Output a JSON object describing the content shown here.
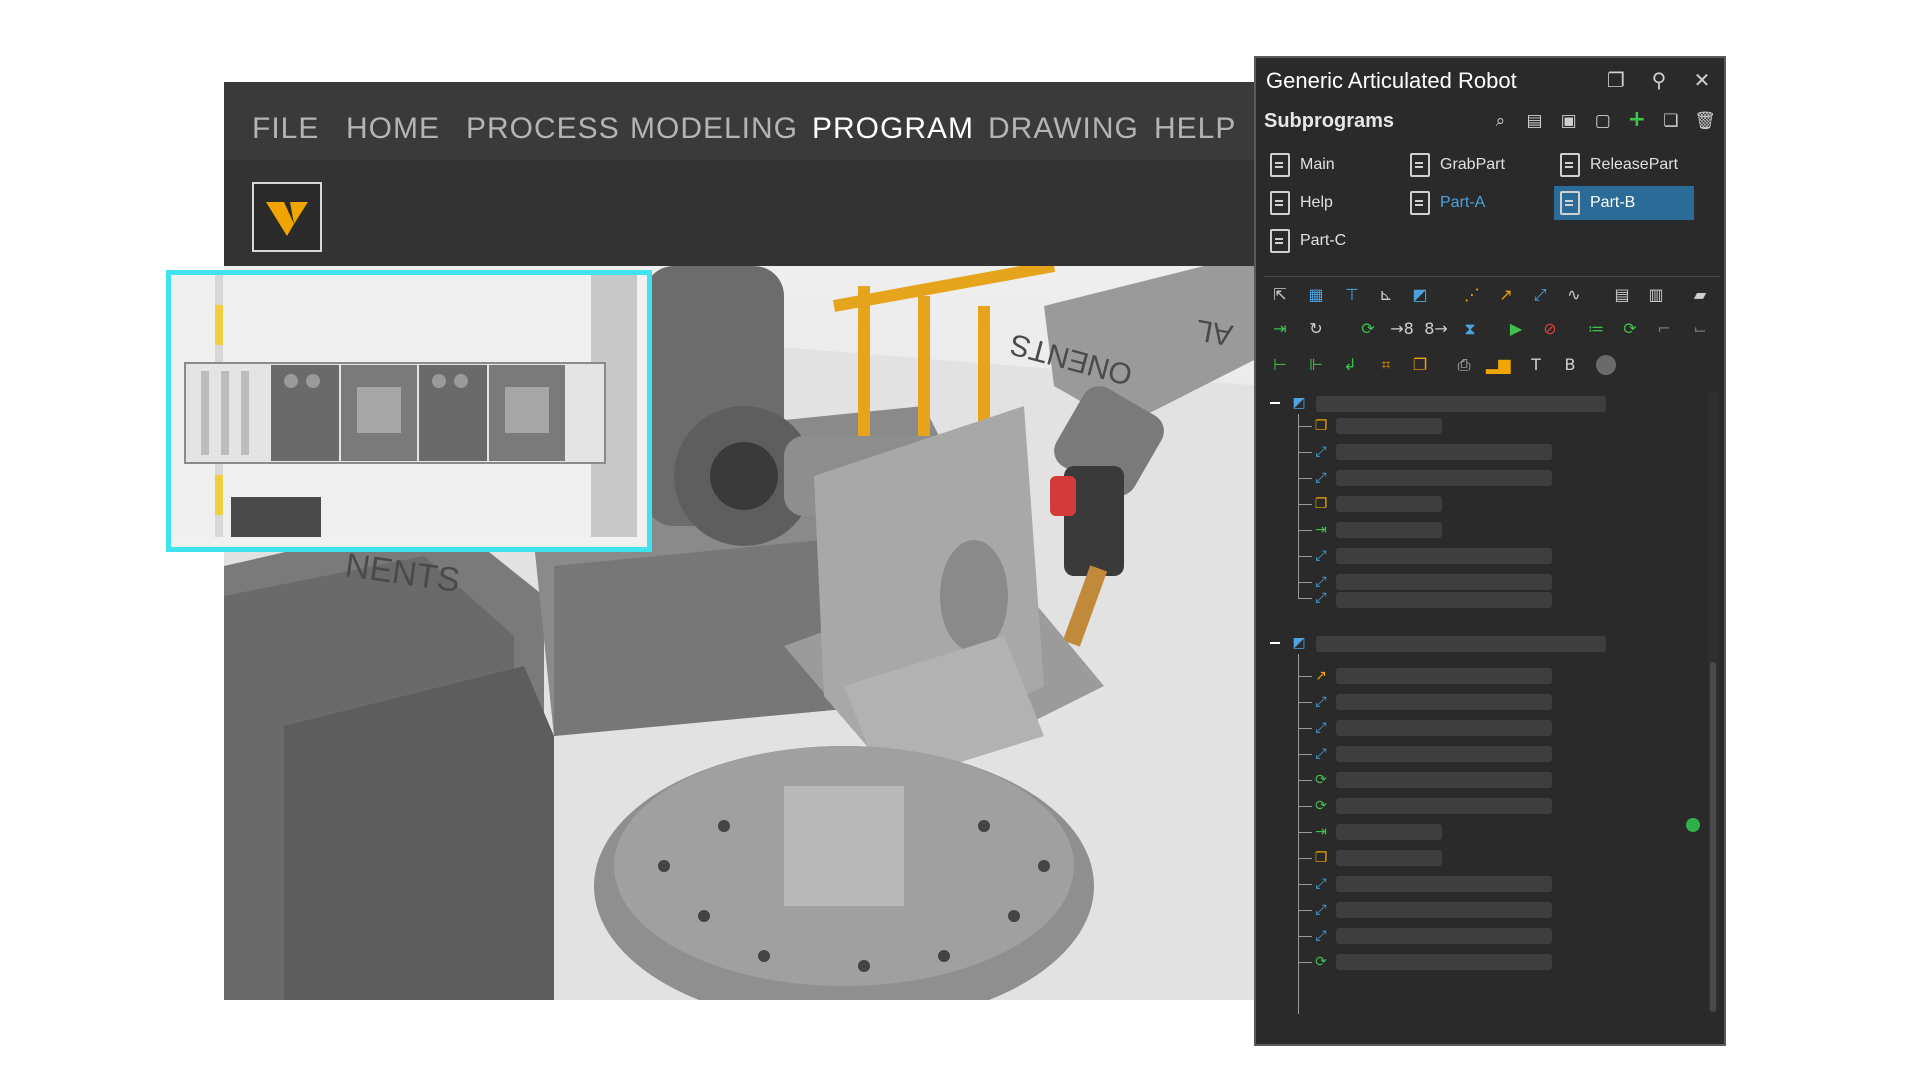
{
  "menu": [
    "FILE",
    "HOME",
    "PROCESS",
    "MODELING",
    "PROGRAM",
    "DRAWING",
    "HELP"
  ],
  "active_menu": "PROGRAM",
  "logo": "V",
  "viewport": {
    "labels": [
      "NENTS",
      "ONENTS",
      "AL"
    ]
  },
  "panel": {
    "title": "Generic Articulated Robot",
    "title_icons": [
      "restore-icon",
      "pin-icon",
      "close-icon"
    ],
    "subprograms_label": "Subprograms",
    "subprogram_toolbar_icons": [
      "search-icon",
      "clipboard-icon",
      "new-doc-icon",
      "new-doc2-icon",
      "add-icon",
      "copy-icon",
      "delete-icon"
    ],
    "programs": [
      {
        "label": "Main",
        "state": "normal"
      },
      {
        "label": "GrabPart",
        "state": "normal"
      },
      {
        "label": "ReleasePart",
        "state": "normal"
      },
      {
        "label": "Help",
        "state": "normal"
      },
      {
        "label": "Part-A",
        "state": "link"
      },
      {
        "label": "Part-B",
        "state": "selected"
      },
      {
        "label": "Part-C",
        "state": "normal"
      }
    ],
    "toolbar_text": {
      "t": "T",
      "b": "B"
    },
    "colors": {
      "accent": "#2a6c97",
      "link": "#4aa3df",
      "green": "#3ec24a",
      "orange": "#f0a500",
      "highlight": "#3fe3ee"
    }
  }
}
